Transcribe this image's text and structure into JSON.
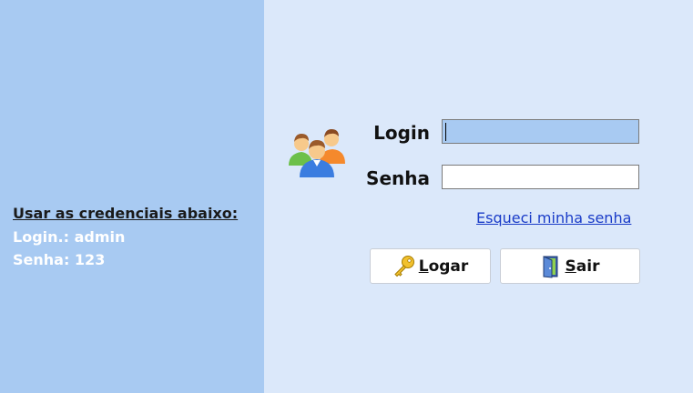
{
  "credentials": {
    "title": "Usar as credenciais abaixo:",
    "login_line": "Login.: admin",
    "senha_line": "Senha: 123"
  },
  "form": {
    "login_label": "Login",
    "senha_label": "Senha",
    "login_value": "",
    "senha_value": "",
    "forgot_link": "Esqueci minha senha"
  },
  "buttons": {
    "logar_label": "Logar",
    "sair_label": "Sair"
  },
  "icons": {
    "users": "users-group-icon",
    "key": "key-icon",
    "exit": "door-exit-icon"
  },
  "colors": {
    "left_panel": "#a8caf2",
    "right_panel": "#dbe8fa",
    "link": "#1a3cc8"
  }
}
